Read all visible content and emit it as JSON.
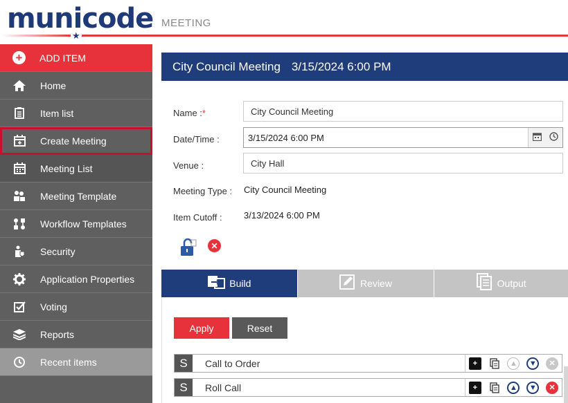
{
  "header": {
    "logo_text": "municode",
    "app_title": "MEETING"
  },
  "sidebar": {
    "items": [
      {
        "label": "ADD ITEM",
        "icon": "plus-circle-icon"
      },
      {
        "label": "Home",
        "icon": "home-icon"
      },
      {
        "label": "Item list",
        "icon": "list-icon"
      },
      {
        "label": "Create Meeting",
        "icon": "calendar-add-icon"
      },
      {
        "label": "Meeting List",
        "icon": "calendar-list-icon"
      },
      {
        "label": "Meeting Template",
        "icon": "template-icon"
      },
      {
        "label": "Workflow Templates",
        "icon": "workflow-icon"
      },
      {
        "label": "Security",
        "icon": "security-icon"
      },
      {
        "label": "Application Properties",
        "icon": "gear-icon"
      },
      {
        "label": "Voting",
        "icon": "checkbox-icon"
      },
      {
        "label": "Reports",
        "icon": "layers-icon"
      },
      {
        "label": "Recent items",
        "icon": "history-icon"
      }
    ]
  },
  "meeting": {
    "title": "City Council Meeting",
    "datetime_title": "3/15/2024 6:00 PM",
    "name_label": "Name :",
    "name_required": "*",
    "name_value": "City Council Meeting",
    "datetime_label": "Date/Time :",
    "datetime_value": "3/15/2024 6:00 PM",
    "venue_label": "Venue :",
    "venue_value": "City Hall",
    "type_label": "Meeting Type :",
    "type_value": "City Council Meeting",
    "cutoff_label": "Item Cutoff :",
    "cutoff_value": "3/13/2024 6:00 PM"
  },
  "tabs": [
    {
      "label": "Build",
      "icon": "build-icon"
    },
    {
      "label": "Review",
      "icon": "edit-icon"
    },
    {
      "label": "Output",
      "icon": "documents-icon"
    }
  ],
  "build": {
    "apply_label": "Apply",
    "reset_label": "Reset",
    "items": [
      {
        "badge": "S",
        "label": "Call to Order"
      },
      {
        "badge": "S",
        "label": "Roll Call"
      }
    ]
  },
  "colors": {
    "brand_blue": "#1f3d7a",
    "brand_red": "#e8323b",
    "sidebar_bg": "#5f5f5f"
  }
}
